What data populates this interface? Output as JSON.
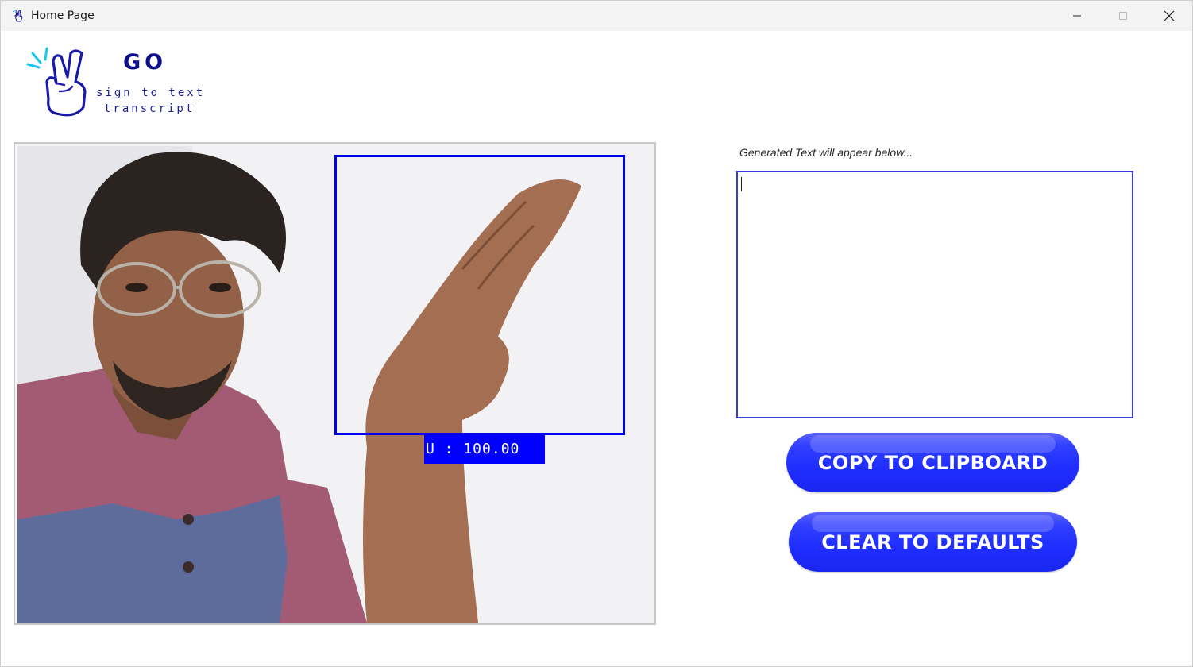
{
  "window": {
    "title": "Home Page",
    "icon": "peace-hand-icon"
  },
  "logo": {
    "title": "GO",
    "subtitle_line1": "sign to text",
    "subtitle_line2": "transcript"
  },
  "camera": {
    "prediction_label": "U : 100.00"
  },
  "output": {
    "label": "Generated Text will appear below...",
    "value": ""
  },
  "buttons": {
    "copy_label": "COPY TO CLIPBOARD",
    "clear_label": "CLEAR TO DEFAULTS"
  },
  "colors": {
    "accent": "#2030ff",
    "roi_box": "#0000f0",
    "brand_dark": "#0c0e8a"
  }
}
